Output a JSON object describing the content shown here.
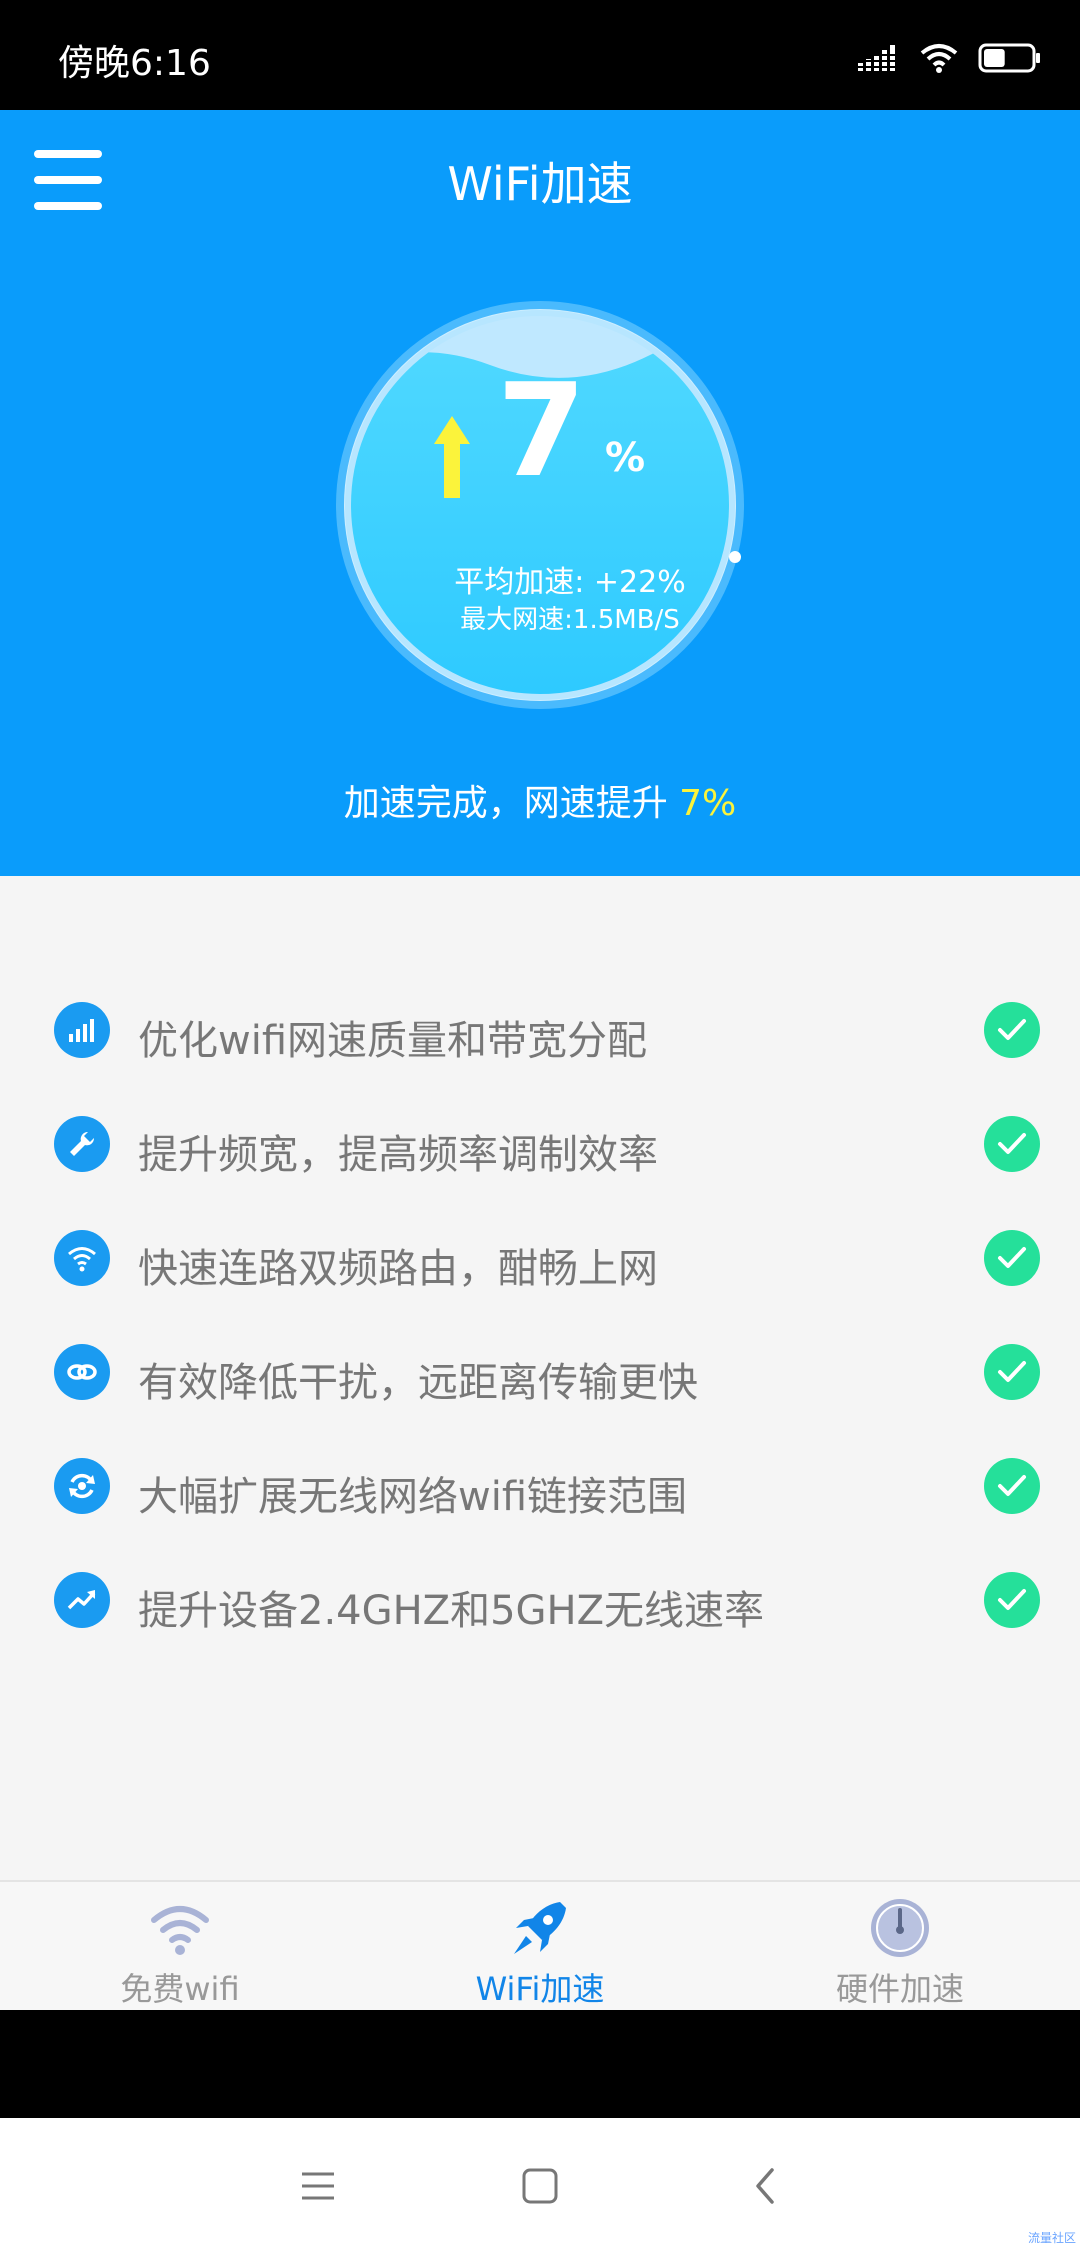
{
  "status_bar": {
    "time": "傍晚6:16",
    "battery_level": 0.45
  },
  "header": {
    "title": "WiFi加速"
  },
  "gauge": {
    "value": "7",
    "unit": "%",
    "avg_speedup": "平均加速: +22%",
    "max_speed": "最大网速:1.5MB/S"
  },
  "result": {
    "text": "加速完成，网速提升 ",
    "highlight": "7%"
  },
  "features": [
    {
      "label": "优化wifi网速质量和带宽分配",
      "icon": "signal-bars-icon"
    },
    {
      "label": "提升频宽，提高频率调制效率",
      "icon": "wrench-icon"
    },
    {
      "label": "快速连路双频路由，酣畅上网",
      "icon": "wifi-icon"
    },
    {
      "label": "有效降低干扰，远距离传输更快",
      "icon": "link-icon"
    },
    {
      "label": "大幅扩展无线网络wifi链接范围",
      "icon": "refresh-icon"
    },
    {
      "label": "提升设备2.4GHZ和5GHZ无线速率",
      "icon": "trend-up-icon"
    }
  ],
  "tabs": [
    {
      "label": "免费wifi",
      "icon": "wifi-icon",
      "active": false
    },
    {
      "label": "WiFi加速",
      "icon": "rocket-icon",
      "active": true
    },
    {
      "label": "硬件加速",
      "icon": "speedometer-icon",
      "active": false
    }
  ],
  "watermark": "流量社区",
  "colors": {
    "primary": "#0a9cfb",
    "highlight": "#fbf33b",
    "check": "#25e09a",
    "active_tab": "#1185e8"
  }
}
